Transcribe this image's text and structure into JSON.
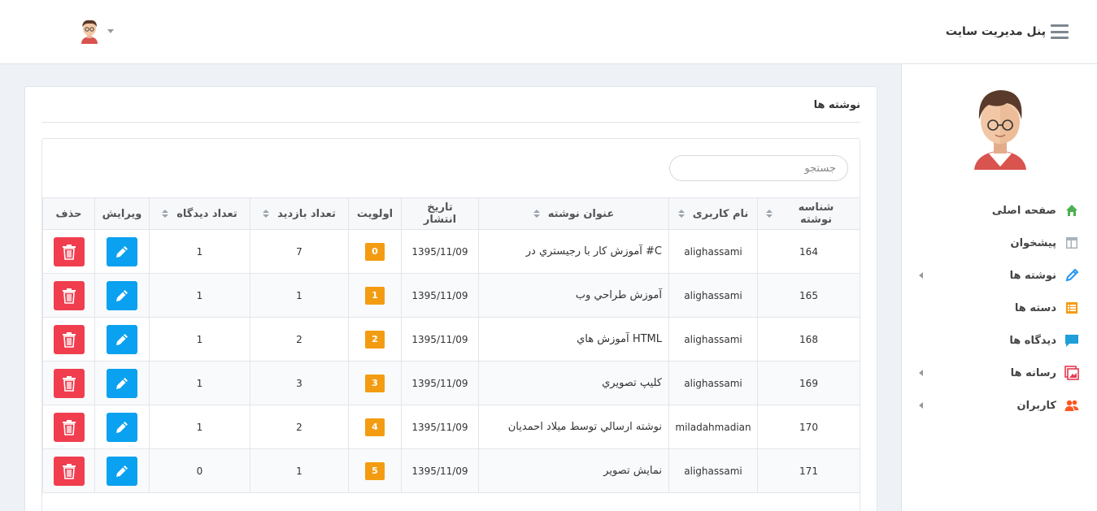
{
  "header": {
    "brand_title": "پنل مدیریت سایت"
  },
  "sidebar": {
    "items": [
      {
        "label": "صفحه اصلی",
        "icon": "home-icon",
        "color": "#4caf50",
        "has_arrow": false
      },
      {
        "label": "پیشخوان",
        "icon": "dashboard-icon",
        "color": "#aab2b9",
        "has_arrow": false
      },
      {
        "label": "نوشته ها",
        "icon": "pencil-icon",
        "color": "#2196f3",
        "has_arrow": true
      },
      {
        "label": "دسته ها",
        "icon": "list-icon",
        "color": "#f39c12",
        "has_arrow": false
      },
      {
        "label": "دیدگاه ها",
        "icon": "comment-icon",
        "color": "#1e9fd8",
        "has_arrow": false
      },
      {
        "label": "رسانه ها",
        "icon": "image-icon",
        "color": "#e53950",
        "has_arrow": true
      },
      {
        "label": "کاربران",
        "icon": "users-icon",
        "color": "#ff5722",
        "has_arrow": true
      }
    ]
  },
  "main": {
    "panel_title": "نوشته ها",
    "search_placeholder": "جستجو",
    "columns": [
      "شناسه نوشته",
      "نام کاربری",
      "عنوان نوشته",
      "تاریخ انتشار",
      "اولویت",
      "تعداد بازدید",
      "تعداد دیدگاه",
      "ویرایش",
      "حذف"
    ],
    "rows": [
      {
        "id": "164",
        "username": "alighassami",
        "title": "C# آموزش کار با رجيستري در",
        "date": "1395/11/09",
        "priority": "0",
        "views": "7",
        "comments": "1"
      },
      {
        "id": "165",
        "username": "alighassami",
        "title": "آموزش طراحي وب",
        "date": "1395/11/09",
        "priority": "1",
        "views": "1",
        "comments": "1"
      },
      {
        "id": "168",
        "username": "alighassami",
        "title": "HTML آموزش هاي",
        "date": "1395/11/09",
        "priority": "2",
        "views": "2",
        "comments": "1"
      },
      {
        "id": "169",
        "username": "alighassami",
        "title": "كليپ تصويري",
        "date": "1395/11/09",
        "priority": "3",
        "views": "3",
        "comments": "1"
      },
      {
        "id": "170",
        "username": "miladahmadian",
        "title": "نوشته ارسالي توسط ميلاد احمديان",
        "date": "1395/11/09",
        "priority": "4",
        "views": "2",
        "comments": "1"
      },
      {
        "id": "171",
        "username": "alighassami",
        "title": "نمايش تصوير",
        "date": "1395/11/09",
        "priority": "5",
        "views": "1",
        "comments": "0"
      }
    ]
  },
  "colors": {
    "edit_button": "#0aa1f0",
    "delete_button": "#f03e4f",
    "priority_badge": "#f39c12"
  }
}
